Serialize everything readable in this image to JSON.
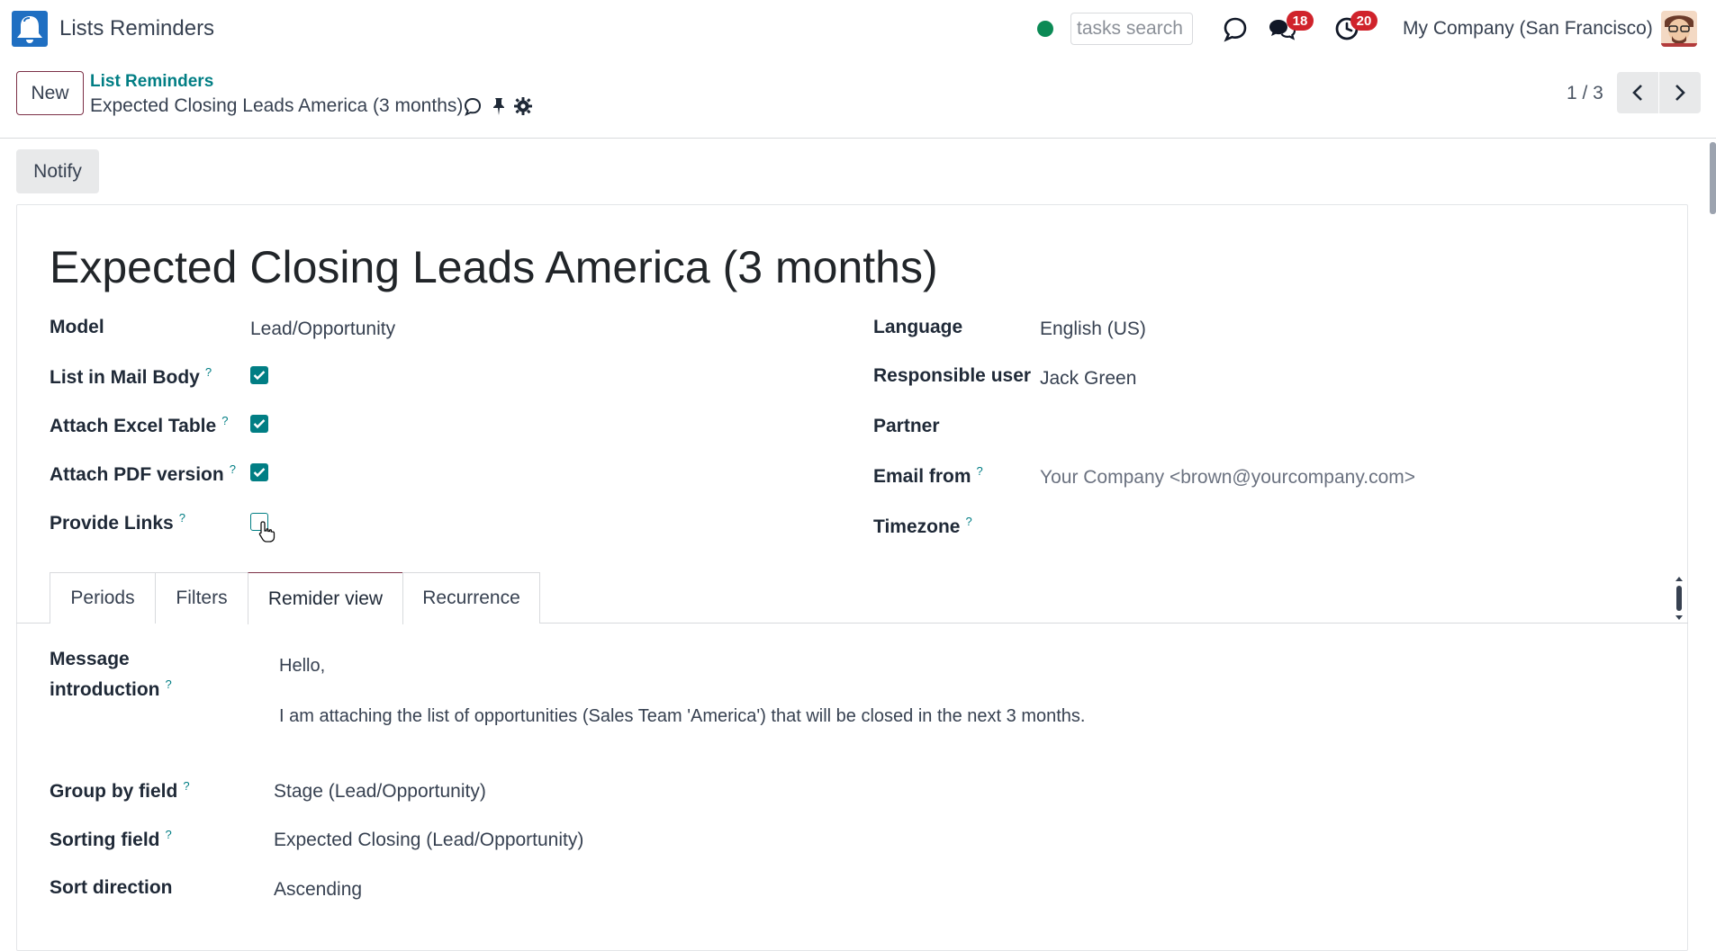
{
  "app": {
    "title": "Lists Reminders",
    "search_placeholder": "tasks search",
    "messages_count": "18",
    "activities_count": "20",
    "company": "My Company (San Francisco)",
    "accent_color": "#017e84",
    "brand_color": "#7c3046"
  },
  "control_panel": {
    "new_label": "New",
    "breadcrumb": "List Reminders",
    "record_name": "Expected Closing Leads America (3 months)",
    "pager": "1 / 3"
  },
  "statusbar": {
    "notify_label": "Notify"
  },
  "form": {
    "title": "Expected Closing Leads America (3 months)",
    "left": {
      "model_label": "Model",
      "model_value": "Lead/Opportunity",
      "list_in_body_label": "List in Mail Body",
      "list_in_body_checked": true,
      "attach_excel_label": "Attach Excel Table",
      "attach_excel_checked": true,
      "attach_pdf_label": "Attach PDF version",
      "attach_pdf_checked": true,
      "provide_links_label": "Provide Links",
      "provide_links_checked": false
    },
    "right": {
      "language_label": "Language",
      "language_value": "English (US)",
      "responsible_label": "Responsible user",
      "responsible_value": "Jack Green",
      "partner_label": "Partner",
      "partner_value": "",
      "email_from_label": "Email from",
      "email_from_value": "Your Company <brown@yourcompany.com>",
      "timezone_label": "Timezone",
      "timezone_value": ""
    },
    "help_mark": "?",
    "tabs": [
      {
        "label": "Periods",
        "active": false
      },
      {
        "label": "Filters",
        "active": false
      },
      {
        "label": "Remider view",
        "active": true
      },
      {
        "label": "Recurrence",
        "active": false
      }
    ],
    "reminder_view": {
      "message_intro_label_1": "Message",
      "message_intro_label_2": "introduction",
      "message_line_1": "Hello,",
      "message_line_2": "I am attaching the list of opportunities (Sales Team 'America') that will be closed in the next 3 months.",
      "group_by_label": "Group by field",
      "group_by_value": "Stage (Lead/Opportunity)",
      "sorting_label": "Sorting field",
      "sorting_value": "Expected Closing (Lead/Opportunity)",
      "sort_direction_label": "Sort direction",
      "sort_direction_value": "Ascending"
    }
  },
  "icons": [
    "bell-app-icon",
    "chat-bubble-icon",
    "messages-icon",
    "activity-clock-icon",
    "user-avatar",
    "chatter-icon",
    "pin-icon",
    "gear-icon",
    "chevron-left-icon",
    "chevron-right-icon",
    "pointer-cursor-icon"
  ]
}
